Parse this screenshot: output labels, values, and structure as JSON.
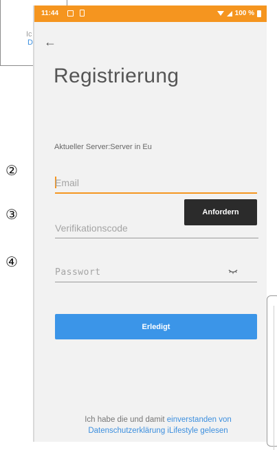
{
  "background": {
    "text": "Ic",
    "link": "D"
  },
  "status_bar": {
    "time": "11:44",
    "battery": "100 %",
    "color": "#f5951f"
  },
  "screen": {
    "title": "Registrierung",
    "server_label": "Aktueller Server:Server in Eu",
    "email_placeholder": "Email",
    "code_placeholder": "Verifikationscode",
    "request_button": "Anfordern",
    "password_placeholder": "Passwort",
    "done_button": "Erledigt",
    "terms_prefix": "Ich habe die und damit ",
    "terms_link_1": "einverstanden von",
    "terms_link_2": "Datenschutzerklärung iLifestyle gelesen"
  },
  "annotations": {
    "step_2": "②",
    "step_3": "③",
    "step_4": "④"
  },
  "colors": {
    "accent": "#f5951f",
    "primary_button": "#3b95e8",
    "dark_button": "#2b2b2b",
    "link": "#3b8ede"
  },
  "icons": [
    "back-arrow-icon",
    "message-icon",
    "sim-icon",
    "wifi-icon",
    "signal-icon",
    "battery-icon",
    "eye-icon"
  ]
}
